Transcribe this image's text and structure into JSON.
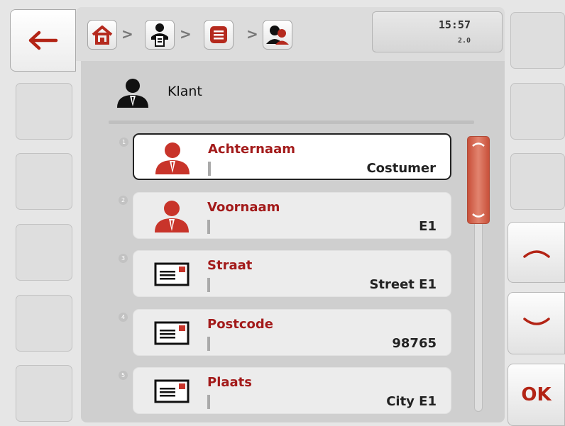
{
  "header": {
    "clock_time": "15:57",
    "version": "2.0",
    "separator": ">"
  },
  "breadcrumb": [
    {
      "name": "home",
      "icon": "home-icon"
    },
    {
      "name": "customers",
      "icon": "customer-card-icon"
    },
    {
      "name": "list",
      "icon": "list-icon"
    },
    {
      "name": "customer",
      "icon": "customer-icon"
    }
  ],
  "panel": {
    "title": "Klant",
    "title_icon": "person-icon"
  },
  "fields": [
    {
      "number": "1",
      "label": "Achternaam",
      "value": "Costumer",
      "icon": "person-icon",
      "selected": true
    },
    {
      "number": "2",
      "label": "Voornaam",
      "value": "E1",
      "icon": "person-icon",
      "selected": false
    },
    {
      "number": "3",
      "label": "Straat",
      "value": "Street E1",
      "icon": "address-card-icon",
      "selected": false
    },
    {
      "number": "4",
      "label": "Postcode",
      "value": "98765",
      "icon": "address-card-icon",
      "selected": false
    },
    {
      "number": "5",
      "label": "Plaats",
      "value": "City E1",
      "icon": "address-card-icon",
      "selected": false
    }
  ],
  "right_buttons": {
    "ok_label": "OK"
  },
  "colors": {
    "accent_red": "#a31b1b",
    "icon_red": "#c8342a",
    "scroll_thumb": "#c8503a",
    "home_red": "#b52a1e"
  }
}
